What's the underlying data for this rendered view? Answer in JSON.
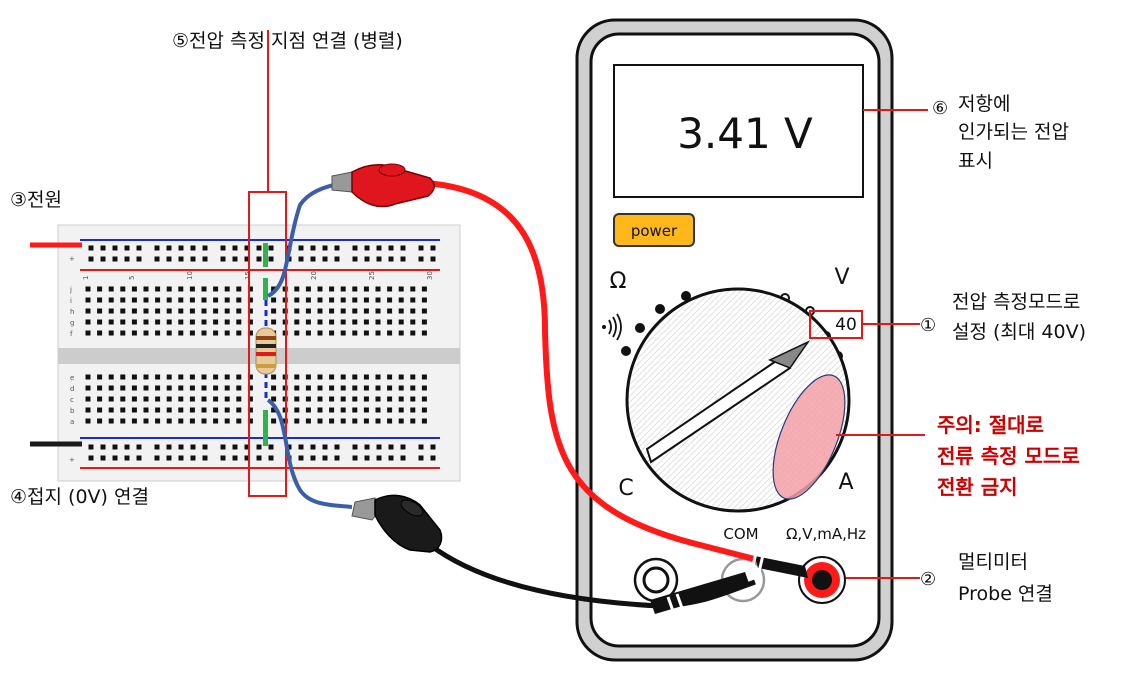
{
  "annotations": {
    "parallel": "⑤전압 측정 지점 연결 (병렬)",
    "power": "③전원",
    "ground": "④접지 (0V) 연결",
    "display": [
      "⑥",
      "저항에",
      "인가되는 전압",
      "표시"
    ],
    "mode": [
      "①",
      "전압 측정모드로",
      "설정 (최대 40V)"
    ],
    "warning": [
      "주의: 절대로",
      "전류 측정 모드로",
      "전환 금지"
    ],
    "probe": [
      "②",
      "멀티미터",
      "Probe 연결"
    ]
  },
  "meter": {
    "reading": "3.41 V",
    "power_label": "power",
    "dial_ohm": "Ω",
    "dial_volt": "V",
    "dial_current": "A",
    "dial_cap": "C",
    "range_40": "40",
    "jack_com": "COM",
    "jack_v": "Ω,V,mA,Hz"
  },
  "breadboard": {
    "columns": [
      "1",
      "5",
      "10",
      "15",
      "20",
      "25",
      "30"
    ],
    "rows_top": [
      "j",
      "i",
      "h",
      "g",
      "f"
    ],
    "rows_bottom": [
      "e",
      "d",
      "c",
      "b",
      "a"
    ],
    "rail_plus": "+",
    "rail_minus": "-"
  },
  "colors": {
    "red_wire": "#ff1a1a",
    "black_wire": "#1a1a1a",
    "blue_wire": "#3a5fa8",
    "annotation_red": "#cc0000",
    "power_button": "#ffb71a"
  }
}
